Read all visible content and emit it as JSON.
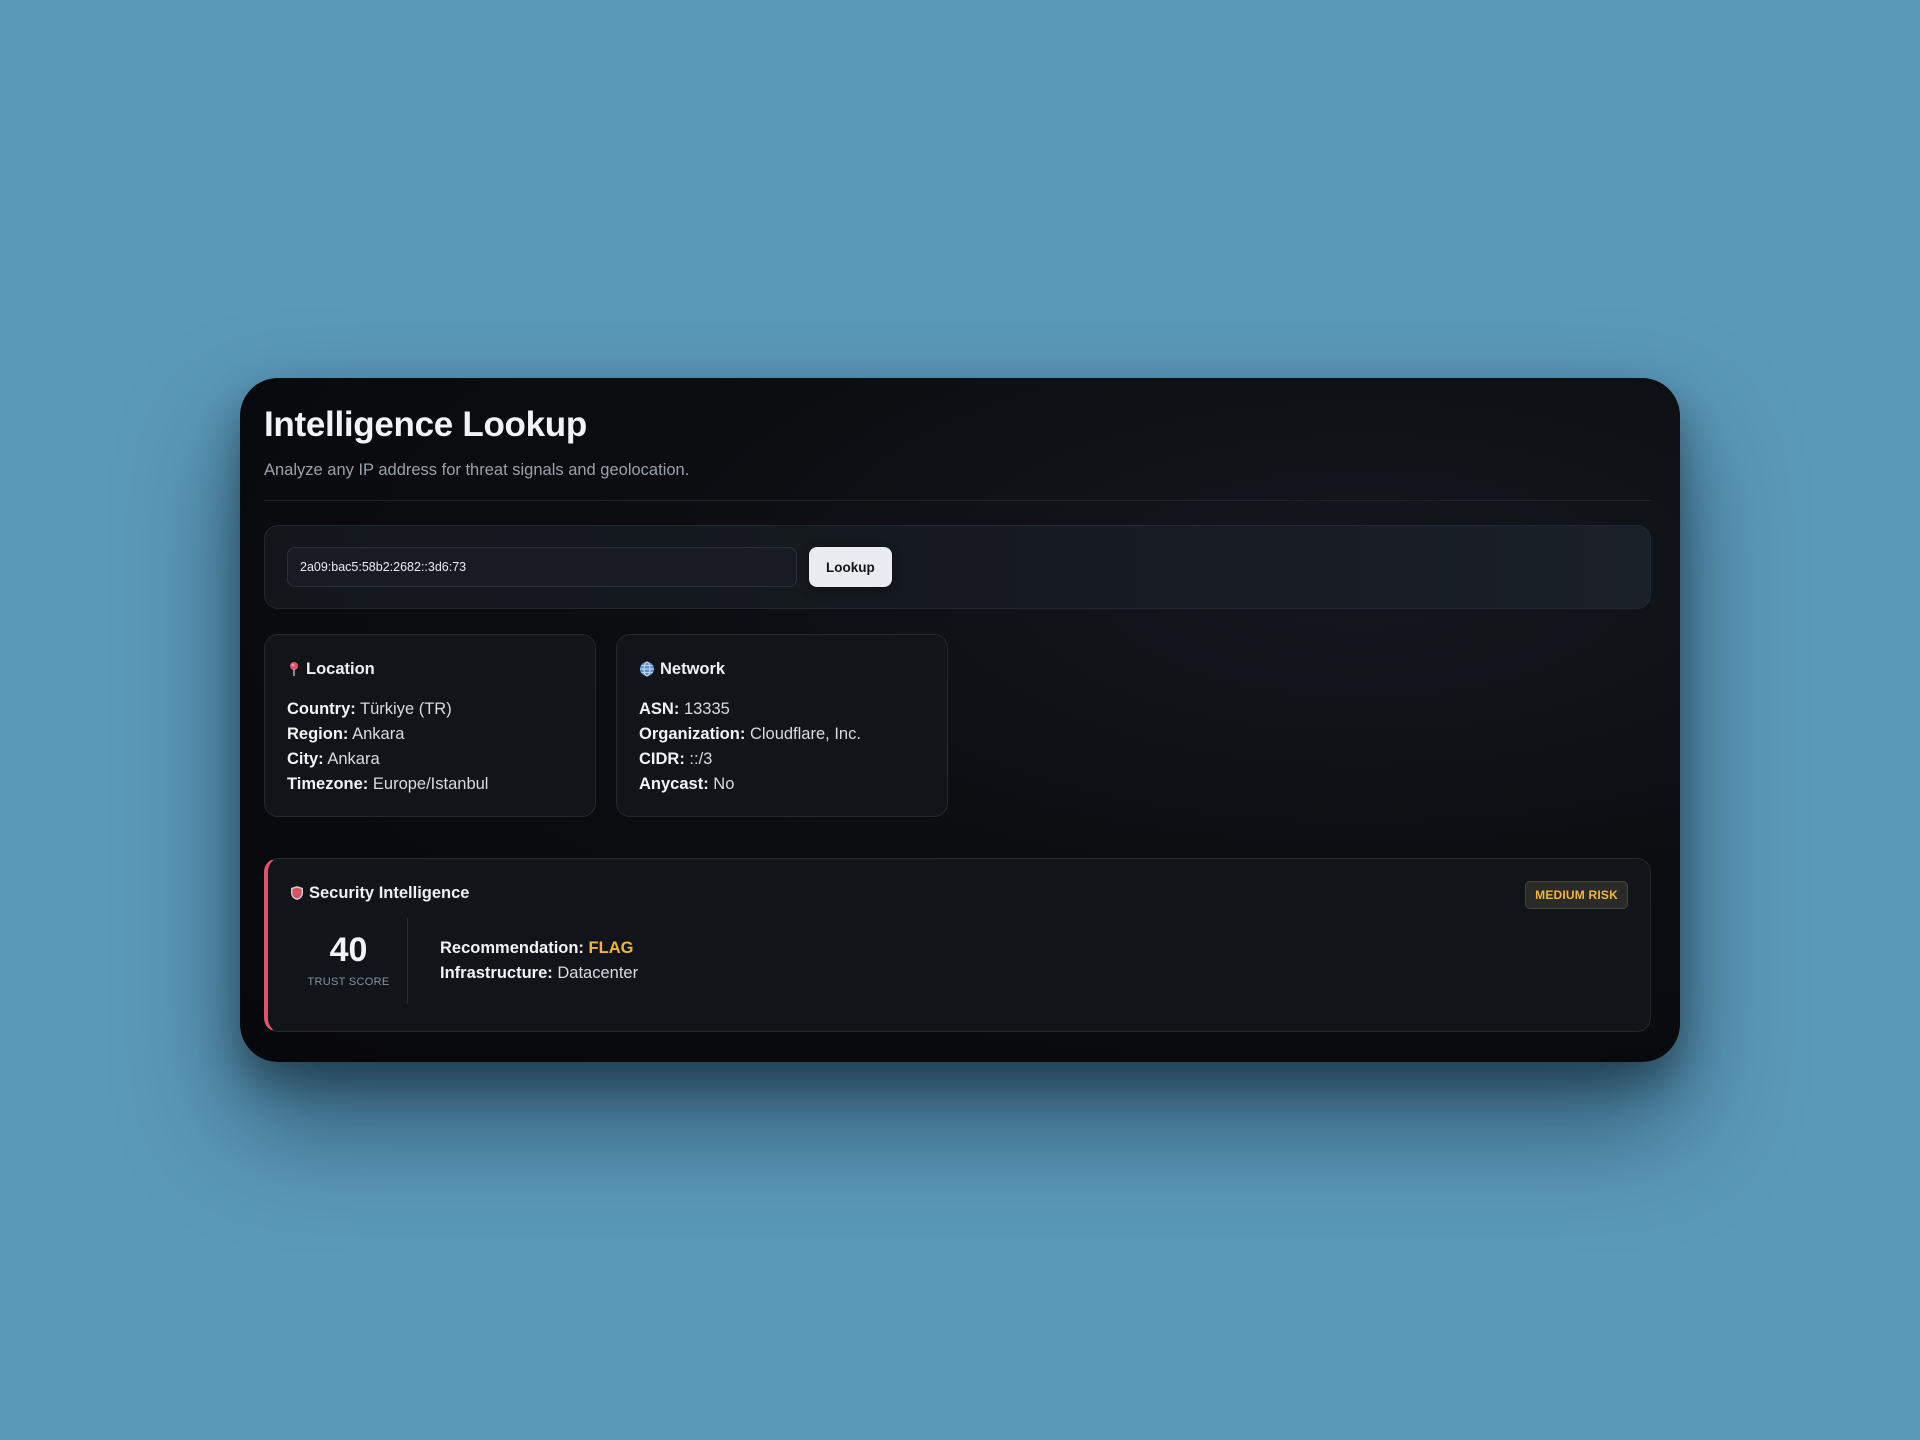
{
  "header": {
    "title": "Intelligence Lookup",
    "subtitle": "Analyze any IP address for threat signals and geolocation."
  },
  "search": {
    "value": "2a09:bac5:58b2:2682::3d6:73",
    "button_label": "Lookup"
  },
  "location": {
    "title": "Location",
    "icon": "pin-icon",
    "rows": [
      {
        "key": "Country:",
        "value": "Türkiye (TR)"
      },
      {
        "key": "Region:",
        "value": "Ankara"
      },
      {
        "key": "City:",
        "value": "Ankara"
      },
      {
        "key": "Timezone:",
        "value": "Europe/Istanbul"
      }
    ]
  },
  "network": {
    "title": "Network",
    "icon": "globe-icon",
    "rows": [
      {
        "key": "ASN:",
        "value": "13335"
      },
      {
        "key": "Organization:",
        "value": "Cloudflare, Inc."
      },
      {
        "key": "CIDR:",
        "value": "::/3"
      },
      {
        "key": "Anycast:",
        "value": "No"
      }
    ]
  },
  "security": {
    "title": "Security Intelligence",
    "icon": "shield-icon",
    "badge": "MEDIUM RISK",
    "score": "40",
    "score_label": "TRUST SCORE",
    "recommendation_key": "Recommendation:",
    "recommendation_value": "FLAG",
    "infrastructure_key": "Infrastructure:",
    "infrastructure_value": "Datacenter",
    "accent_color": "#e0546a",
    "warn_color": "#f2b53a"
  }
}
